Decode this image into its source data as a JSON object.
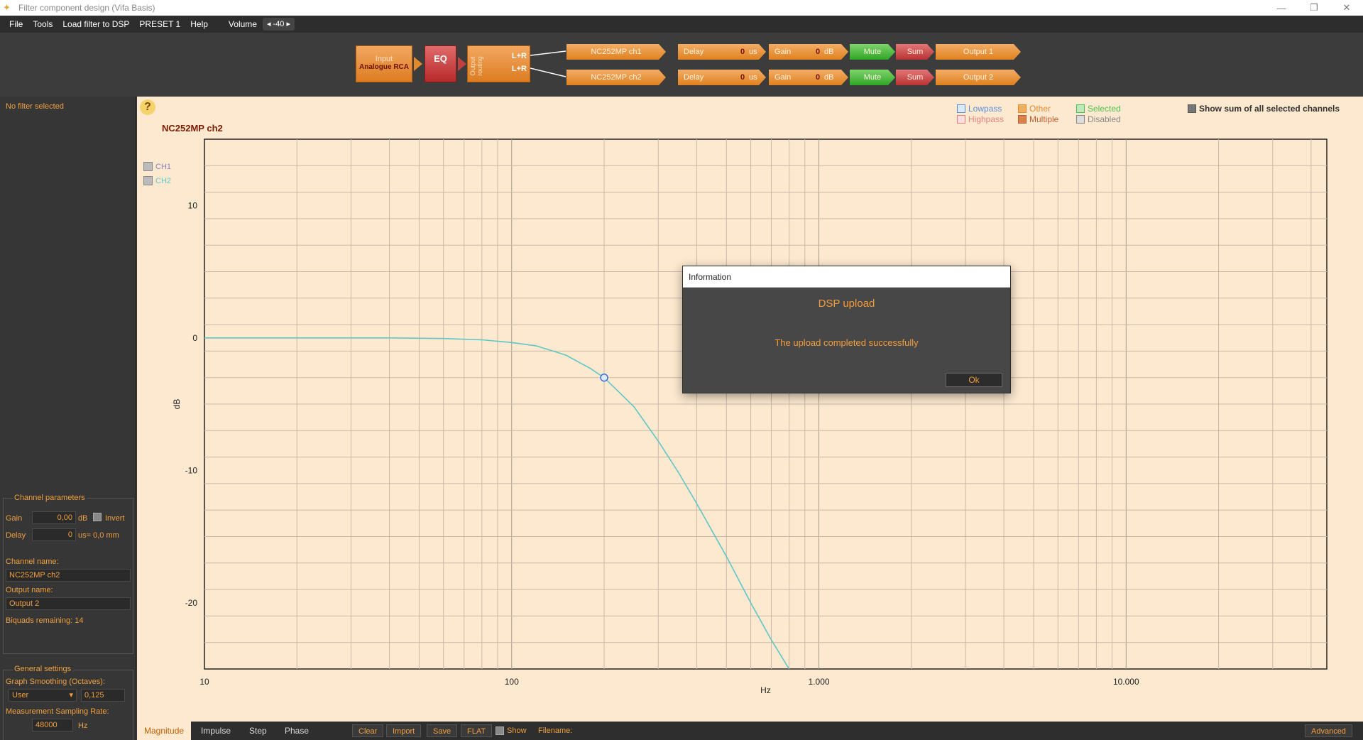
{
  "window": {
    "title": "Filter component design (Vifa Basis)",
    "controls": [
      "—",
      "❐",
      "✕"
    ]
  },
  "menu": {
    "items": [
      "File",
      "Tools",
      "Load filter to DSP",
      "PRESET 1",
      "Help"
    ],
    "volume_label": "Volume",
    "volume_value": "◂ -40 ▸"
  },
  "chain": {
    "input_label": "Input",
    "input_source": "Analogue RCA",
    "eq_label": "EQ",
    "routing_label": "Output routing",
    "routing_lr": "L+R",
    "channels": [
      {
        "name": "NC252MP ch1",
        "delay_label": "Delay",
        "delay_value": "0",
        "delay_unit": "us",
        "gain_label": "Gain",
        "gain_value": "0",
        "gain_unit": "dB",
        "mute_label": "Mute",
        "sum_label": "Sum",
        "output_label": "Output 1"
      },
      {
        "name": "NC252MP ch2",
        "delay_label": "Delay",
        "delay_value": "0",
        "delay_unit": "us",
        "gain_label": "Gain",
        "gain_value": "0",
        "gain_unit": "dB",
        "mute_label": "Mute",
        "sum_label": "Sum",
        "output_label": "Output 2"
      }
    ]
  },
  "left": {
    "no_filter": "No filter selected",
    "channel_params_title": "Channel parameters",
    "gain_label": "Gain",
    "gain_value": "0,00",
    "gain_unit": "dB",
    "invert_label": "Invert",
    "delay_label": "Delay",
    "delay_value": "0",
    "delay_unit": "us= 0,0 mm",
    "channel_name_label": "Channel name:",
    "channel_name_value": "NC252MP ch2",
    "output_name_label": "Output name:",
    "output_name_value": "Output 2",
    "biquads": "Biquads remaining: 14",
    "general_title": "General settings",
    "smoothing_label": "Graph Smoothing (Octaves):",
    "smoothing_mode": "User",
    "smoothing_value": "0,125",
    "sampling_label": "Measurement Sampling Rate:",
    "sampling_value": "48000",
    "sampling_unit": "Hz"
  },
  "main": {
    "help": "?",
    "chart_title": "NC252MP ch2",
    "ch_toggles": [
      "CH1",
      "CH2"
    ],
    "legend": [
      {
        "label": "Lowpass",
        "color": "#5b8fd8",
        "fill": "#dde8f8"
      },
      {
        "label": "Highpass",
        "color": "#e58080",
        "fill": "#f8dede"
      },
      {
        "label": "Other",
        "color": "#e08a2a",
        "fill": "#f0b060"
      },
      {
        "label": "Multiple",
        "color": "#c06030",
        "fill": "#d8804a"
      },
      {
        "label": "Selected",
        "color": "#4cbf4c",
        "fill": "#bfe8bf"
      },
      {
        "label": "Disabled",
        "color": "#888888",
        "fill": "#dddddd"
      }
    ],
    "show_sum_label": "Show sum of all selected channels"
  },
  "chart_data": {
    "type": "line",
    "xlabel": "Hz",
    "ylabel": "dB",
    "x_scale": "log",
    "xlim": [
      10,
      45000
    ],
    "ylim": [
      -25,
      15
    ],
    "x_ticks": [
      10,
      100,
      1000,
      10000
    ],
    "x_tick_labels": [
      "10",
      "100",
      "1.000",
      "10.000"
    ],
    "y_ticks": [
      10,
      0,
      -10,
      -20
    ],
    "y_tick_labels": [
      "10",
      "0",
      "-10",
      "-20"
    ],
    "grid": true,
    "series": [
      {
        "color": "#5fc6c6",
        "x": [
          10,
          20,
          40,
          60,
          80,
          100,
          120,
          150,
          180,
          200,
          250,
          300,
          350,
          400,
          500,
          600,
          700,
          800,
          830
        ],
        "y": [
          0,
          0,
          0,
          -0.05,
          -0.15,
          -0.35,
          -0.6,
          -1.3,
          -2.3,
          -3.0,
          -5.2,
          -7.8,
          -10.2,
          -12.5,
          -16.5,
          -20.0,
          -22.8,
          -25.0,
          -25.5
        ]
      }
    ],
    "marker": {
      "x": 200,
      "y": -3.0,
      "color": "#3b6fd0"
    }
  },
  "dialog": {
    "title": "Information",
    "heading": "DSP upload",
    "message": "The upload completed successfully",
    "ok_label": "Ok"
  },
  "bottom": {
    "tabs": [
      "Magnitude",
      "Impulse",
      "Step",
      "Phase"
    ],
    "buttons": [
      "Clear",
      "Import",
      "Save",
      "FLAT"
    ],
    "show_label": "Show",
    "filename_label": "Filename:",
    "advanced_label": "Advanced"
  }
}
